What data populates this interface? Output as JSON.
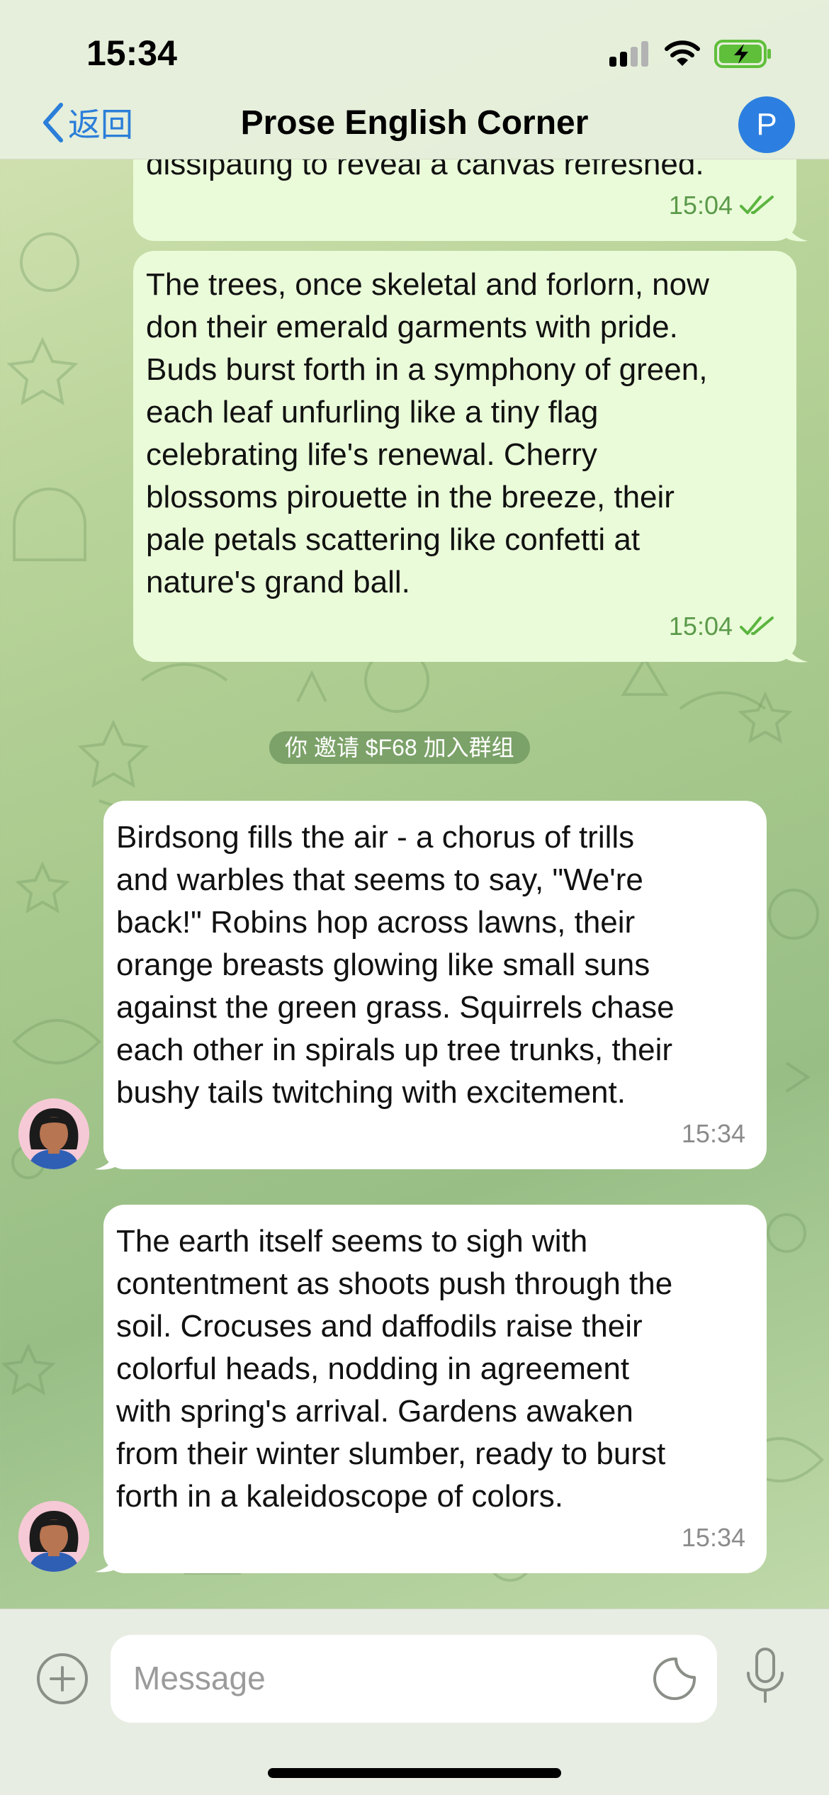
{
  "status_bar": {
    "time": "15:34"
  },
  "header": {
    "back_label": "返回",
    "title": "Prose English Corner",
    "avatar_letter": "P"
  },
  "messages": [
    {
      "direction": "outgoing",
      "text": "dissipating to reveal a canvas refreshed.",
      "time": "15:04",
      "read": true
    },
    {
      "direction": "outgoing",
      "text": "The trees, once skeletal and forlorn, now\ndon their emerald garments with pride.\nBuds burst forth in a symphony of green,\neach leaf unfurling like a tiny flag\ncelebrating life's renewal. Cherry\nblossoms pirouette in the breeze, their\npale petals scattering like confetti at\nnature's grand ball.",
      "time": "15:04",
      "read": true
    },
    {
      "direction": "incoming",
      "text": "Birdsong fills the air - a chorus of trills\nand warbles that seems to say, \"We're\nback!\" Robins hop across lawns, their\norange breasts glowing like small suns\nagainst the green grass. Squirrels chase\neach other in spirals up tree trunks, their\nbushy tails twitching with excitement.",
      "time": "15:34"
    },
    {
      "direction": "incoming",
      "text": "The earth itself seems to sigh with\ncontentment as shoots push through the\nsoil. Crocuses and daffodils raise their\ncolorful heads, nodding in agreement\nwith spring's arrival. Gardens awaken\nfrom their winter slumber, ready to burst\nforth in a kaleidoscope of colors.",
      "time": "15:34"
    }
  ],
  "service_message": "你 邀请 $F68 加入群组",
  "composer": {
    "placeholder": "Message"
  },
  "colors": {
    "accent": "#2b7ed9",
    "outgoing_bubble": "#eafbd9",
    "incoming_bubble": "#ffffff",
    "read_check": "#5bb53f"
  },
  "icons": {
    "back": "chevron-left-icon",
    "attach": "plus-circle-icon",
    "sticker": "sticker-icon",
    "mic": "microphone-icon",
    "signal": "signal-icon",
    "wifi": "wifi-icon",
    "battery": "battery-charging-icon"
  }
}
